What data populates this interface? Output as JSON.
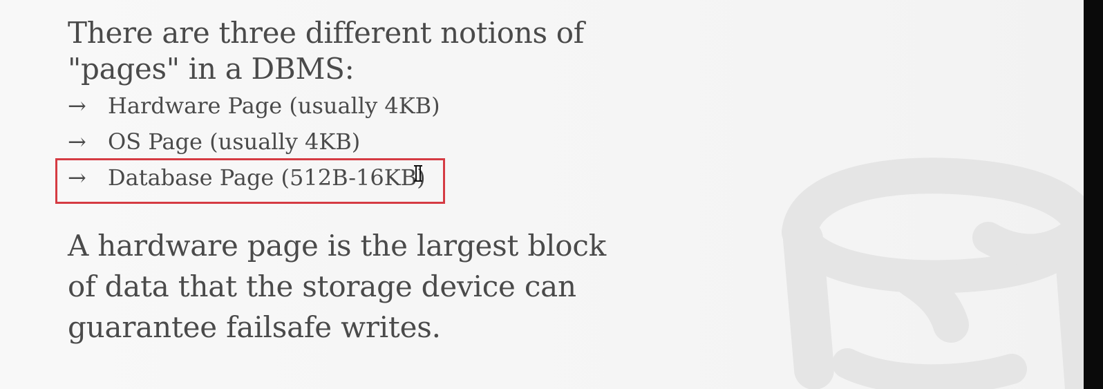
{
  "slide": {
    "intro": {
      "line_1": "There are three different notions of",
      "line_2": "\"pages\" in a DBMS:"
    },
    "bullets": [
      {
        "arrow": "→",
        "text": "Hardware Page (usually 4KB)"
      },
      {
        "arrow": "→",
        "text": "OS Page (usually 4KB)"
      },
      {
        "arrow": "→",
        "text": "Database Page (512B-16KB)"
      }
    ],
    "paragraph": {
      "line_1": "A hardware page is the largest block",
      "line_2": "of data that the storage device can",
      "line_3": "guarantee failsafe writes."
    },
    "colors": {
      "text": "#4a4a4a",
      "highlight": "#d53b43",
      "watermark": "#e5e5e5",
      "background": "#f6f6f6"
    },
    "icons": {
      "watermark": "database-icon",
      "cursor": "text-cursor-icon"
    }
  }
}
